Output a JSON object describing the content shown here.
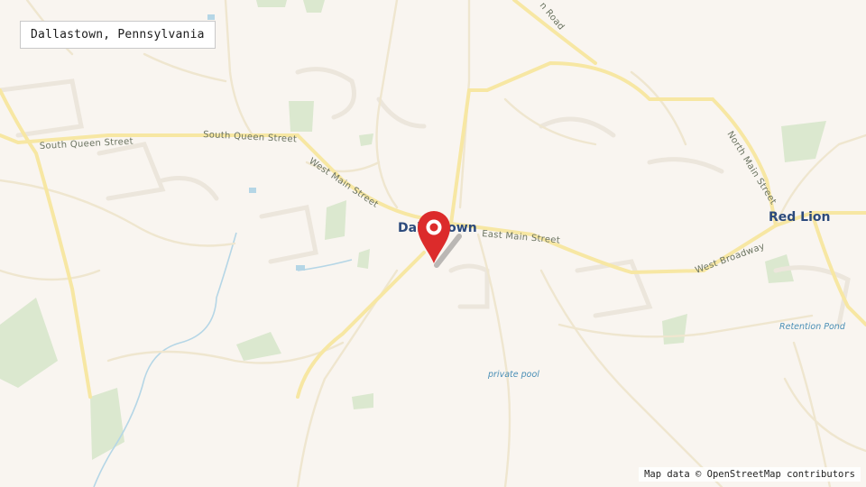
{
  "search": {
    "query": "Dallastown, Pennsylvania"
  },
  "attribution": "Map data © OpenStreetMap contributors",
  "map": {
    "places": {
      "dallastown": "Dallastown",
      "red_lion": "Red Lion"
    },
    "streets": {
      "south_queen_1": "South Queen Street",
      "south_queen_2": "South Queen Street",
      "west_main": "West Main Street",
      "east_main": "East Main Street",
      "west_broadway": "West Broadway",
      "north_main": "North Main Street",
      "road_top": "n Road"
    },
    "water": {
      "retention_pond": "Retention Pond",
      "private_pool": "private pool"
    },
    "marker": {
      "color": "#dc2b2b"
    }
  },
  "colors": {
    "background": "#f9f5f0",
    "road_major": "#f7e7a3",
    "road_minor": "#ebe6dc",
    "park": "#dbe8cf",
    "water": "#b5d6e6",
    "label_place": "#2c4a7c",
    "label_street": "#6b7461"
  }
}
